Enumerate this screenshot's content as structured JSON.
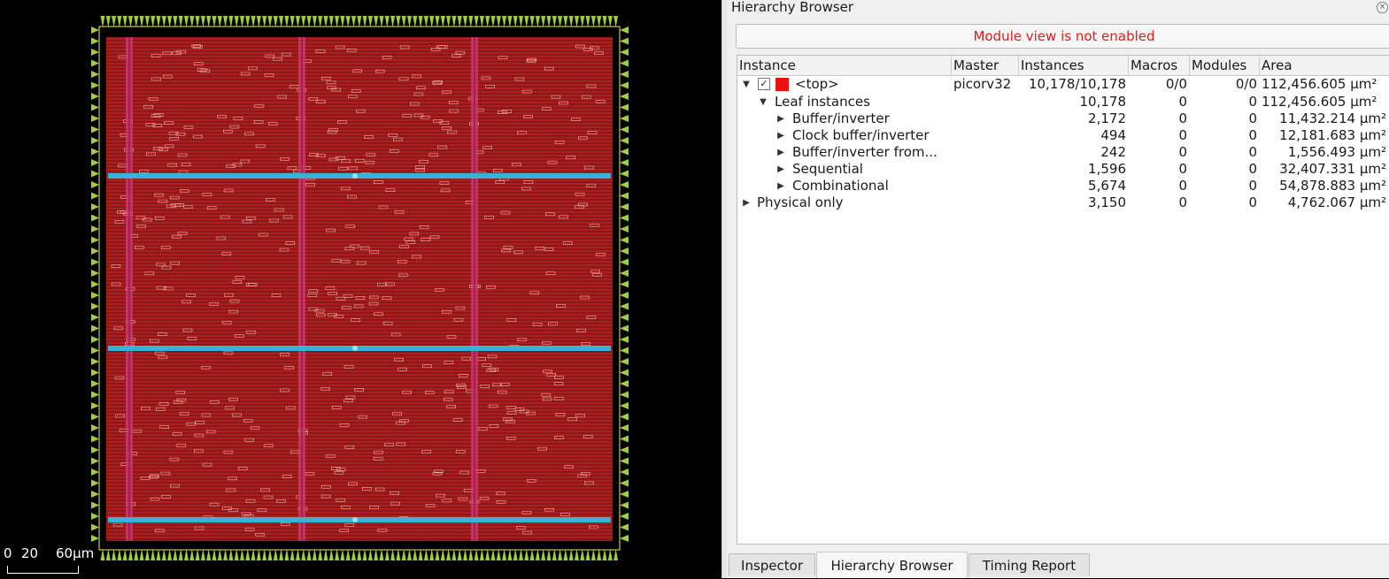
{
  "layout": {
    "scale": {
      "labels": [
        "0",
        "20",
        "60µm"
      ]
    },
    "colors": {
      "background": "#000000",
      "die": "#8a1818",
      "rows": "#ff2d2d",
      "power_straps_vertical": "#d33a78",
      "power_straps_horizontal": "#36b4d6",
      "pins": "#9ecf3c",
      "boundary": "#f0f040"
    }
  },
  "panel": {
    "title": "Hierarchy Browser",
    "close_icon": "close-icon",
    "banner": "Module view is not enabled",
    "columns": [
      "Instance",
      "Master",
      "Instances",
      "Macros",
      "Modules",
      "Area"
    ],
    "rows": [
      {
        "arrow": "▼",
        "name": "<top>",
        "checked": "✓",
        "swatch": "#ee1111",
        "master": "picorv32",
        "instances": "10,178/10,178",
        "macros": "0/0",
        "modules": "0/0",
        "area": "112,456.605 µm²"
      },
      {
        "arrow": "▼",
        "name": "Leaf instances",
        "master": "",
        "instances": "10,178",
        "macros": "0",
        "modules": "0",
        "area": "112,456.605 µm²"
      },
      {
        "arrow": "▶",
        "name": "Buffer/inverter",
        "master": "",
        "instances": "2,172",
        "macros": "0",
        "modules": "0",
        "area": "11,432.214 µm²"
      },
      {
        "arrow": "▶",
        "name": "Clock buffer/inverter",
        "master": "",
        "instances": "494",
        "macros": "0",
        "modules": "0",
        "area": "12,181.683 µm²"
      },
      {
        "arrow": "▶",
        "name": "Buffer/inverter from...",
        "master": "",
        "instances": "242",
        "macros": "0",
        "modules": "0",
        "area": "1,556.493 µm²"
      },
      {
        "arrow": "▶",
        "name": "Sequential",
        "master": "",
        "instances": "1,596",
        "macros": "0",
        "modules": "0",
        "area": "32,407.331 µm²"
      },
      {
        "arrow": "▶",
        "name": "Combinational",
        "master": "",
        "instances": "5,674",
        "macros": "0",
        "modules": "0",
        "area": "54,878.883 µm²"
      },
      {
        "arrow": "▶",
        "name": "Physical only",
        "master": "",
        "instances": "3,150",
        "macros": "0",
        "modules": "0",
        "area": "4,762.067 µm²"
      }
    ]
  },
  "tabs": [
    "Inspector",
    "Hierarchy Browser",
    "Timing Report"
  ],
  "active_tab": "Hierarchy Browser"
}
